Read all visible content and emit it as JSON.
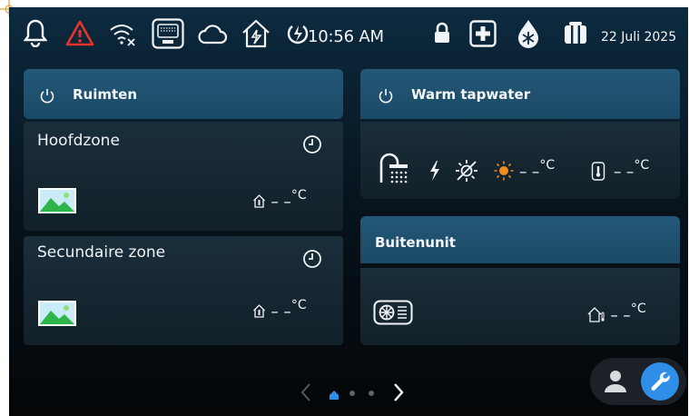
{
  "status_bar": {
    "time": "10:56 AM",
    "date": "22 Juli 2025",
    "icons": [
      "bell-icon",
      "warning-icon",
      "wifi-off-icon",
      "network-port-icon",
      "cloud-icon",
      "home-power-icon",
      "power-lightning-icon",
      "lock-icon",
      "medical-cross-icon",
      "defrost-icon",
      "radiator-icon"
    ]
  },
  "rooms": {
    "title": "Ruimten",
    "zones": [
      {
        "name": "Hoofdzone",
        "temp": "– –",
        "unit": "°C"
      },
      {
        "name": "Secundaire zone",
        "temp": "– –",
        "unit": "°C"
      }
    ]
  },
  "hot_water": {
    "title": "Warm tapwater",
    "temp1": "– –",
    "unit1": "°C",
    "temp2": "– –",
    "unit2": "°C"
  },
  "outdoor_unit": {
    "title": "Buitenunit",
    "temp": "– –",
    "unit": "°C"
  },
  "pagination": {
    "current": 1,
    "total": 3
  },
  "colors": {
    "accent": "#2f8fe8",
    "header": "#235878",
    "warning": "#e8332a",
    "sun": "#f28a1c"
  }
}
